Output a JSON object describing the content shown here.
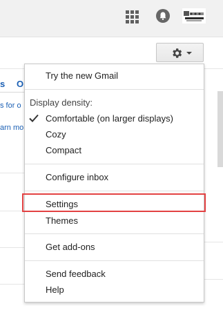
{
  "header": {
    "apps_icon": "apps-grid-icon",
    "notifications_icon": "notifications-bell-icon",
    "account_icon": "account-avatar-icon"
  },
  "toolbar": {
    "settings_icon": "gear-icon",
    "caret_icon": "chevron-down-icon"
  },
  "background": {
    "tab_fragment_1": "s",
    "tab_fragment_2": "O",
    "link_fragment_1": "s for o",
    "link_fragment_2": "arn mo"
  },
  "menu": {
    "try_new": "Try the new Gmail",
    "density_label": "Display density:",
    "density_options": [
      "Comfortable (on larger displays)",
      "Cozy",
      "Compact"
    ],
    "selected_density": "Comfortable (on larger displays)",
    "configure_inbox": "Configure inbox",
    "settings": "Settings",
    "themes": "Themes",
    "get_addons": "Get add-ons",
    "send_feedback": "Send feedback",
    "help": "Help"
  },
  "colors": {
    "highlight_border": "#e34142",
    "link_blue": "#1a5fb4"
  }
}
